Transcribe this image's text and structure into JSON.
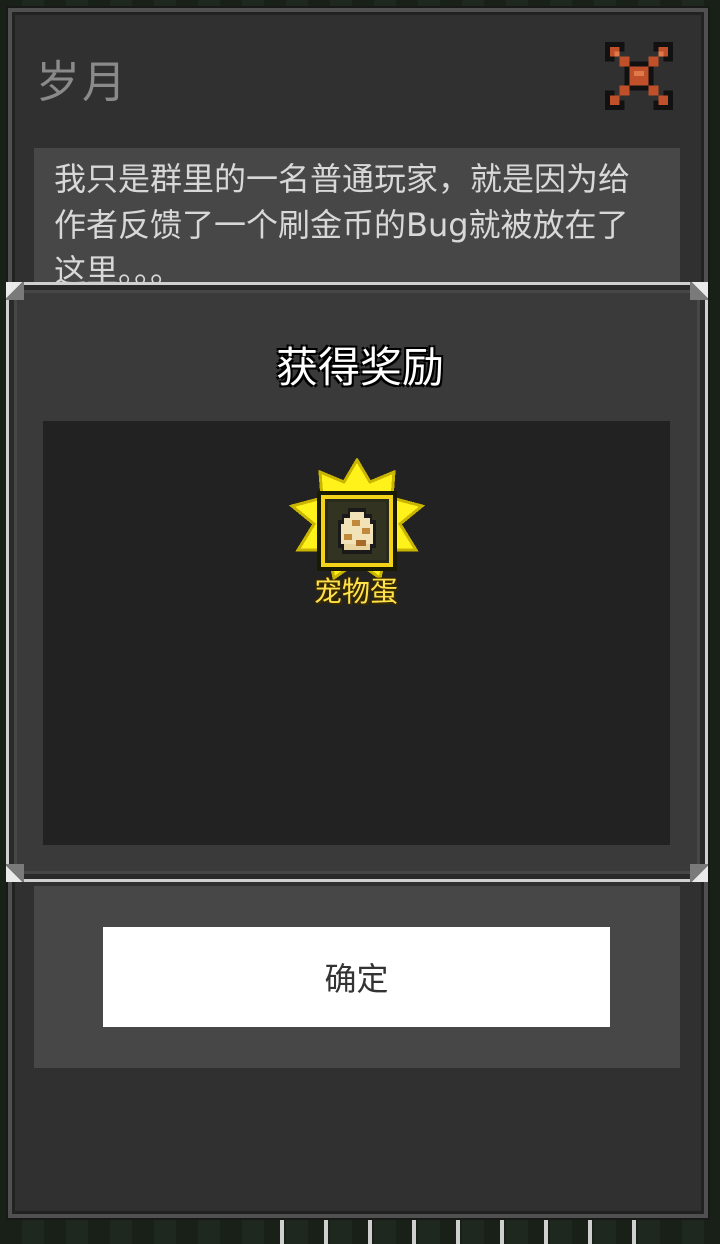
{
  "back_dialog": {
    "title": "岁月",
    "close_icon": "close-x-icon",
    "message": "我只是群里的一名普通玩家，就是因为给作者反馈了一个刷金币的Bug就被放在了这里。。。",
    "confirm_label": "确定"
  },
  "reward_dialog": {
    "title": "获得奖励",
    "items": [
      {
        "name": "宠物蛋",
        "icon": "pet-egg-icon"
      }
    ]
  },
  "colors": {
    "close_icon": "#c0502a",
    "reward_glow": "#ffe24a",
    "panel_bg": "#303030"
  }
}
